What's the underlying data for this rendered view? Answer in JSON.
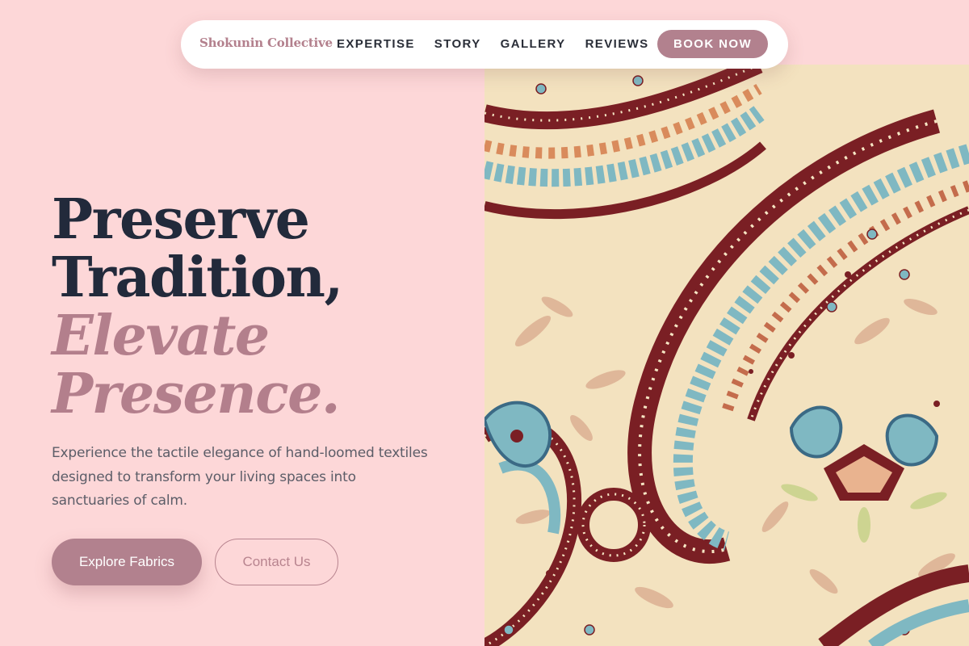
{
  "brand": {
    "name": "Shokunin Collective"
  },
  "nav": {
    "links": [
      {
        "label": "EXPERTISE"
      },
      {
        "label": "STORY"
      },
      {
        "label": "GALLERY"
      },
      {
        "label": "REVIEWS"
      }
    ],
    "cta_label": "BOOK NOW"
  },
  "hero": {
    "headline_line1": "Preserve",
    "headline_line2": "Tradition,",
    "headline_accent_line1": "Elevate",
    "headline_accent_line2": "Presence.",
    "lead": "Experience the tactile elegance of hand-loomed textiles designed to transform your living spaces into sanctuaries of calm.",
    "primary_cta": "Explore Fabrics",
    "secondary_cta": "Contact Us",
    "image_alt": "paisley-fabric"
  },
  "colors": {
    "background": "#fdd7d8",
    "accent": "#b2818e",
    "heading": "#222a3b",
    "text": "#5c5d68",
    "fabric_base": "#f3e2bf",
    "fabric_maroon": "#7a1f24",
    "fabric_teal": "#7fb8c2"
  }
}
